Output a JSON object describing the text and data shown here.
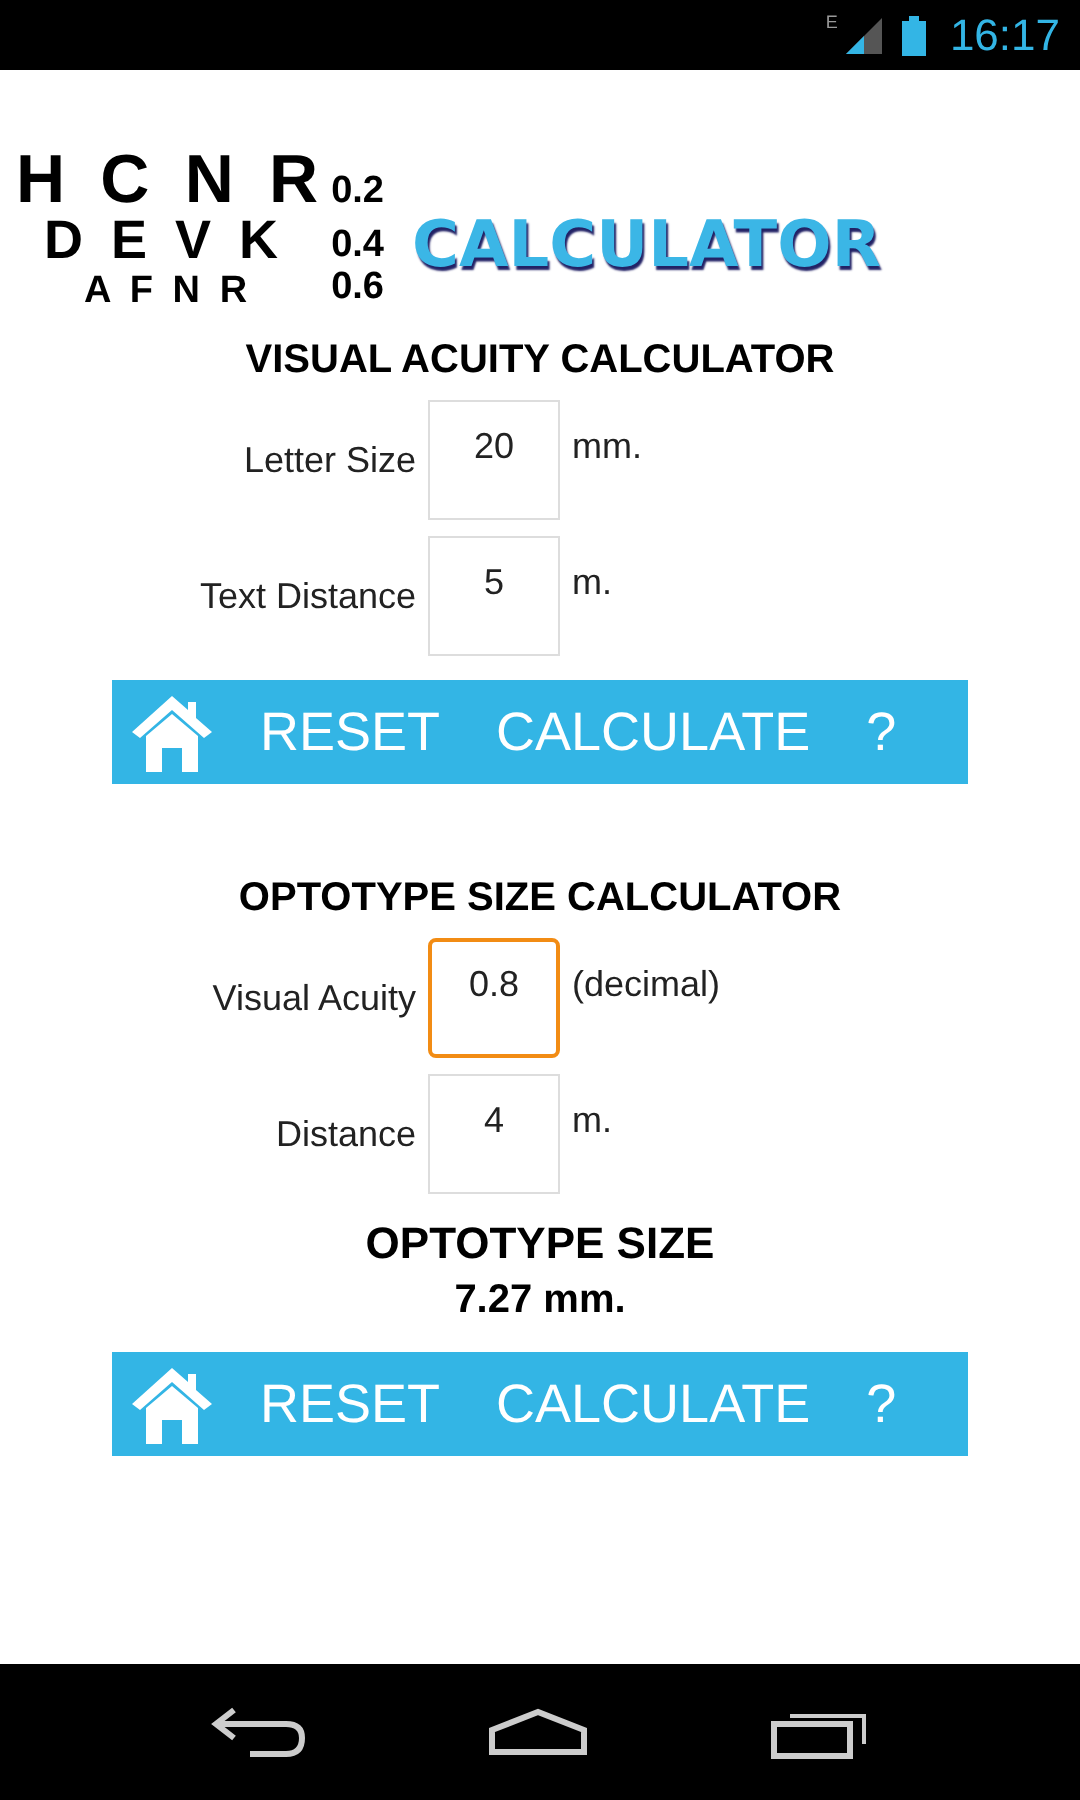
{
  "status_bar": {
    "network": "E",
    "time": "16:17"
  },
  "logo": {
    "rows": [
      {
        "letters": "H C N R",
        "acuity": "0.2"
      },
      {
        "letters": "D E V K",
        "acuity": "0.4"
      },
      {
        "letters": "A F N R",
        "acuity": "0.6"
      }
    ],
    "title": "CALCULATOR"
  },
  "sections": [
    {
      "title": "VISUAL ACUITY CALCULATOR",
      "fields": [
        {
          "label": "Letter Size",
          "value": "20",
          "unit": "mm.",
          "focused": false
        },
        {
          "label": "Text Distance",
          "value": "5",
          "unit": "m.",
          "focused": false
        }
      ],
      "toolbar": {
        "reset": "RESET",
        "calculate": "CALCULATE",
        "help": "?"
      }
    },
    {
      "title": "OPTOTYPE SIZE CALCULATOR",
      "fields": [
        {
          "label": "Visual Acuity",
          "value": "0.8",
          "unit": "(decimal)",
          "focused": true
        },
        {
          "label": "Distance",
          "value": "4",
          "unit": "m.",
          "focused": false
        }
      ],
      "result": {
        "title": "OPTOTYPE SIZE",
        "value": "7.27 mm."
      },
      "toolbar": {
        "reset": "RESET",
        "calculate": "CALCULATE",
        "help": "?"
      }
    }
  ]
}
